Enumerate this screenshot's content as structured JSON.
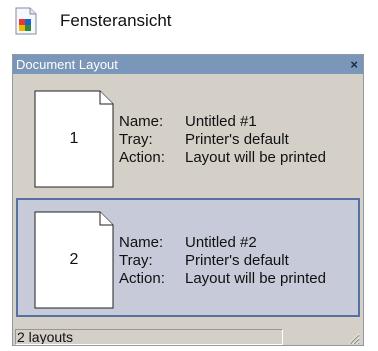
{
  "window": {
    "caption": "Fensteransicht",
    "icon": "document-icon"
  },
  "panel": {
    "title": "Document Layout",
    "close_label": "×"
  },
  "labels": {
    "name": "Name:",
    "tray": "Tray:",
    "action": "Action:"
  },
  "layouts": [
    {
      "page_number": "1",
      "name": "Untitled #1",
      "tray": "Printer's default",
      "action": "Layout will be printed",
      "selected": false
    },
    {
      "page_number": "2",
      "name": "Untitled #2",
      "tray": "Printer's default",
      "action": "Layout will be printed",
      "selected": true
    }
  ],
  "status": {
    "text": "2 layouts"
  },
  "colors": {
    "titlebar": "#7a96b8",
    "panel_bg": "#d4d0c8",
    "selection_bg": "#c7cad8",
    "selection_border": "#5670a0"
  }
}
